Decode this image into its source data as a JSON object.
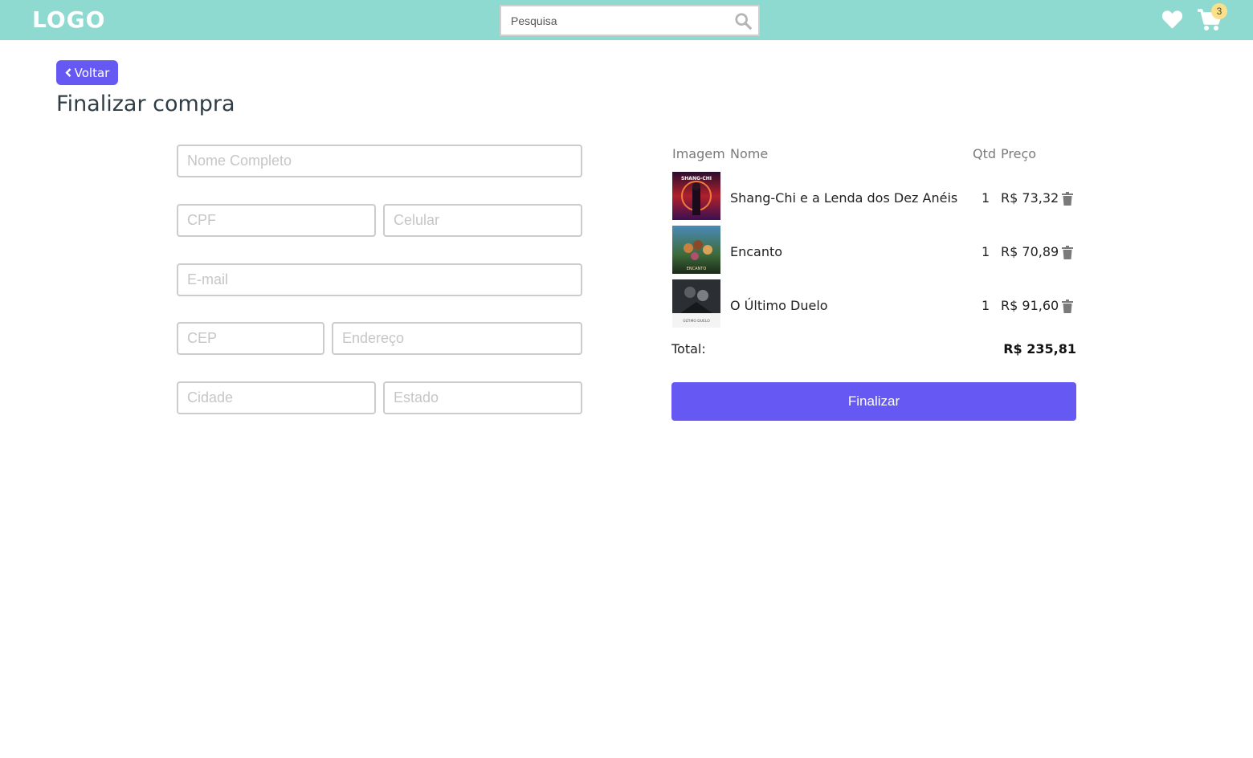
{
  "header": {
    "logo": "LOGO",
    "search_placeholder": "Pesquisa",
    "search_icon": "search-icon",
    "favorites_icon": "heart-icon",
    "cart_icon": "cart-icon",
    "cart_count": "3",
    "colors": {
      "bar": "#8fdad0",
      "badge": "#fbe08a"
    }
  },
  "page": {
    "back_label": "Voltar",
    "title": "Finalizar compra",
    "accent": "#6659f3"
  },
  "form": {
    "full_name": {
      "placeholder": "Nome Completo",
      "value": ""
    },
    "cpf": {
      "placeholder": "CPF",
      "value": ""
    },
    "phone": {
      "placeholder": "Celular",
      "value": ""
    },
    "email": {
      "placeholder": "E-mail",
      "value": ""
    },
    "cep": {
      "placeholder": "CEP",
      "value": ""
    },
    "address": {
      "placeholder": "Endereço",
      "value": ""
    },
    "city": {
      "placeholder": "Cidade",
      "value": ""
    },
    "state": {
      "placeholder": "Estado",
      "value": ""
    }
  },
  "cart": {
    "headers": {
      "image": "Imagem",
      "name": "Nome",
      "qty": "Qtd",
      "price": "Preço"
    },
    "items": [
      {
        "name": "Shang-Chi e a Lenda dos Dez Anéis",
        "qty": "1",
        "price": "R$ 73,32"
      },
      {
        "name": "Encanto",
        "qty": "1",
        "price": "R$ 70,89"
      },
      {
        "name": "O Último Duelo",
        "qty": "1",
        "price": "R$ 91,60"
      }
    ],
    "poster_captions": [
      "SHANG-CHI",
      "ENCANTO",
      "ÚLTIMO DUELO"
    ],
    "total_label": "Total:",
    "total_value": "R$ 235,81",
    "finalize_label": "Finalizar"
  }
}
